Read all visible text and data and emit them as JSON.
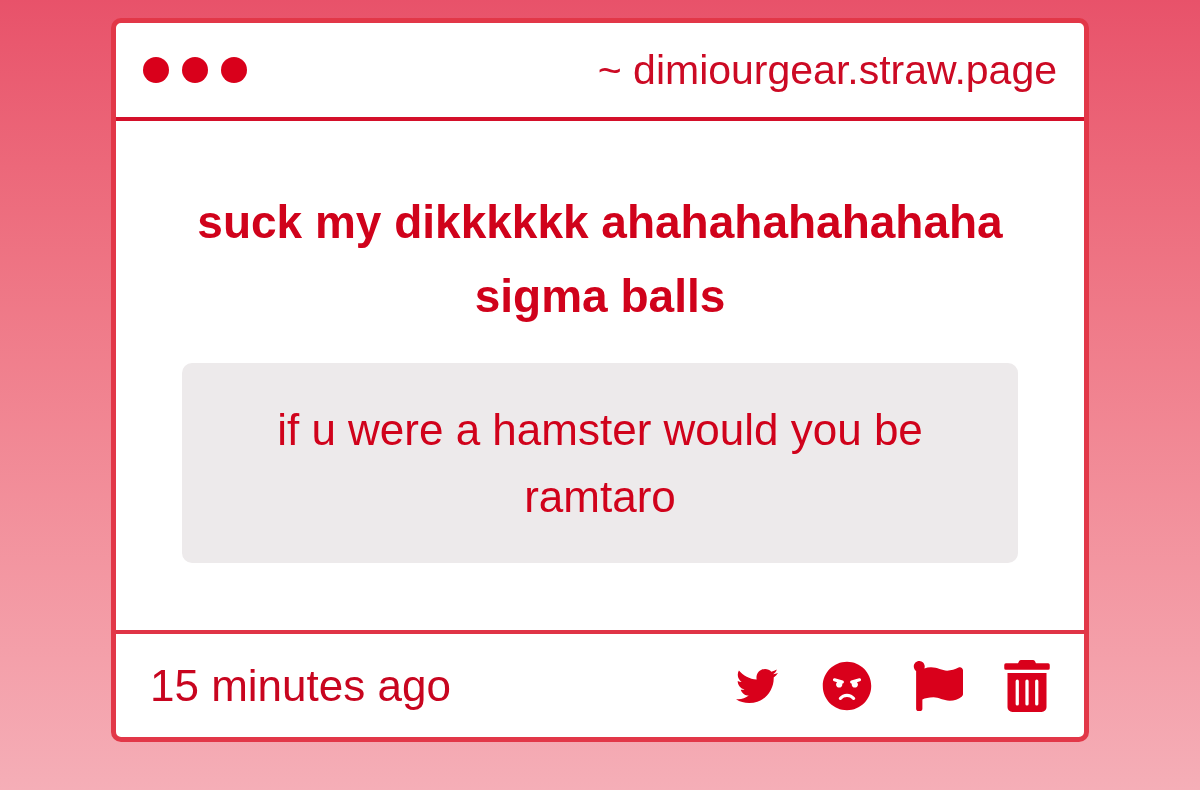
{
  "window": {
    "address": "~ dimiourgear.straw.page"
  },
  "post": {
    "title": "suck my dikkkkkk ahahahahahahaha sigma balls",
    "quote": "if u were a hamster would you be ramtaro"
  },
  "footer": {
    "time": "15 minutes ago",
    "actions": [
      {
        "kind": "twitter"
      },
      {
        "kind": "angry"
      },
      {
        "kind": "flag"
      },
      {
        "kind": "trash"
      }
    ]
  }
}
